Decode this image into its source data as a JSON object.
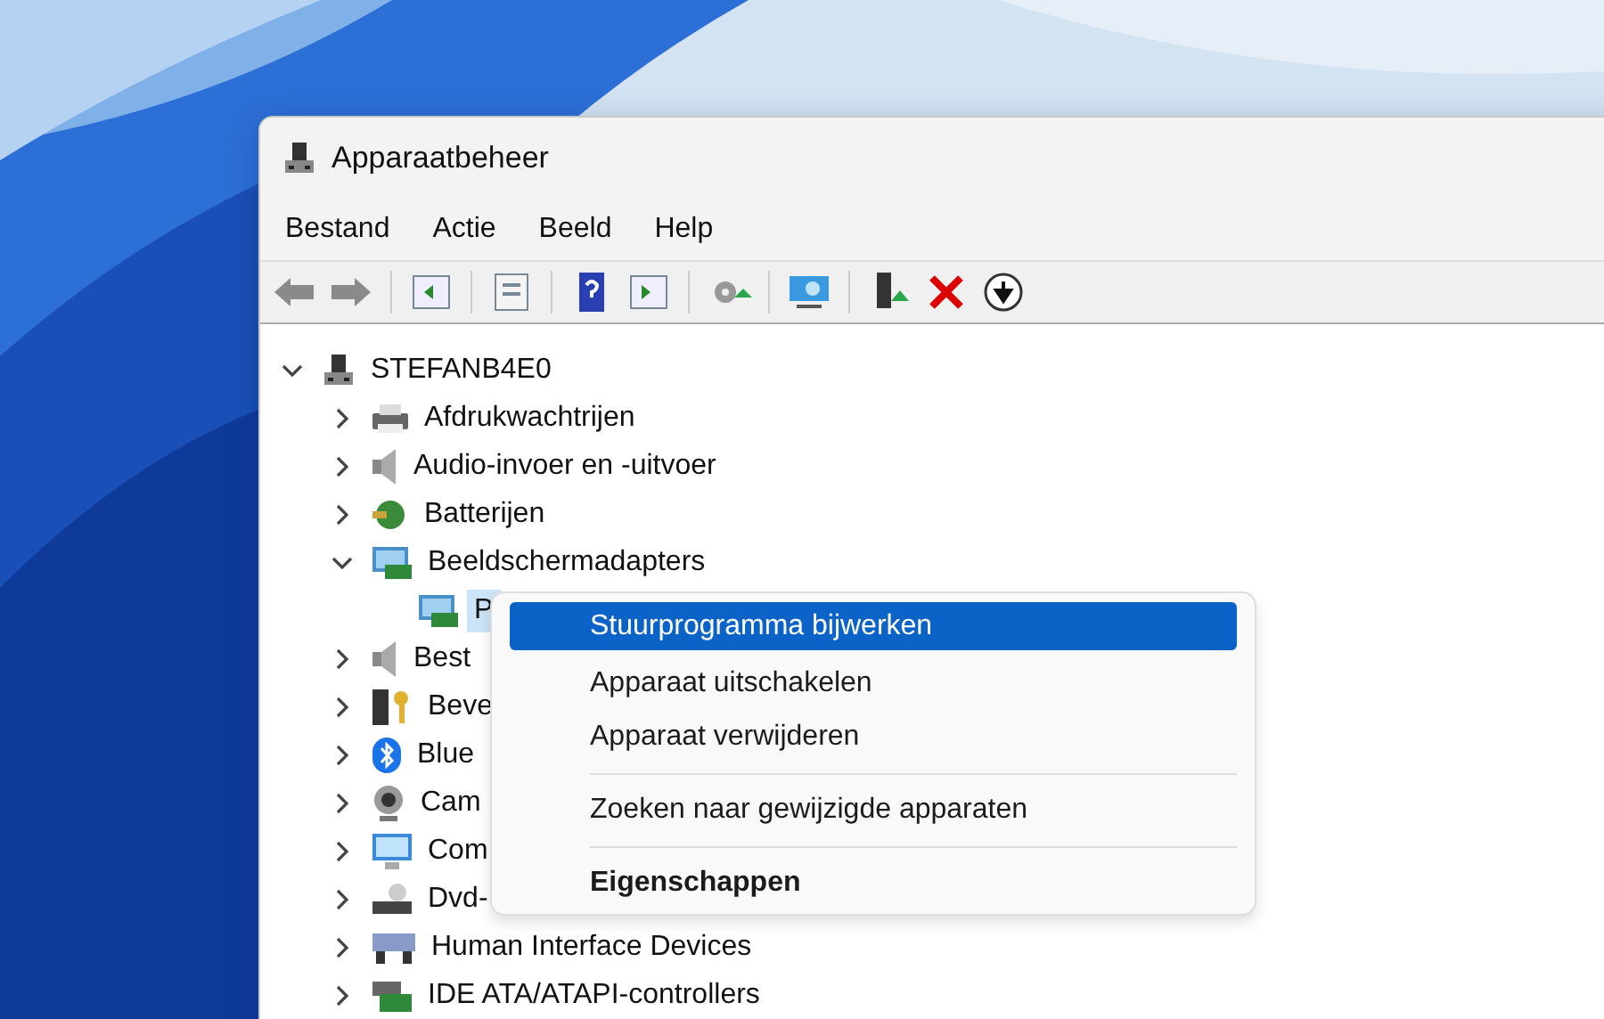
{
  "window": {
    "title": "Apparaatbeheer"
  },
  "menu": [
    {
      "label": "Bestand"
    },
    {
      "label": "Actie"
    },
    {
      "label": "Beeld"
    },
    {
      "label": "Help"
    }
  ],
  "tree": {
    "label": "STEFANB4E0",
    "expanded": true,
    "children": [
      {
        "label": "Afdrukwachtrijen",
        "expanded": false
      },
      {
        "label": "Audio-invoer en -uitvoer",
        "expanded": false
      },
      {
        "label": "Batterijen",
        "expanded": false
      },
      {
        "label": "Beeldschermadapters",
        "expanded": true,
        "children": [
          {
            "label": "P",
            "selected": true
          }
        ]
      },
      {
        "label": "Best",
        "expanded": false
      },
      {
        "label": "Beve",
        "expanded": false
      },
      {
        "label": "Blue",
        "expanded": false
      },
      {
        "label": "Cam",
        "expanded": false
      },
      {
        "label": "Com",
        "expanded": false
      },
      {
        "label": "Dvd-",
        "expanded": false
      },
      {
        "label": "Human Interface Devices",
        "expanded": false
      },
      {
        "label": "IDE ATA/ATAPI-controllers",
        "expanded": false
      }
    ]
  },
  "context_menu": [
    {
      "kind": "item",
      "label": "Stuurprogramma bijwerken",
      "selected": true,
      "default": false
    },
    {
      "kind": "item",
      "label": "Apparaat uitschakelen",
      "selected": false,
      "default": false
    },
    {
      "kind": "item",
      "label": "Apparaat verwijderen",
      "selected": false,
      "default": false
    },
    {
      "kind": "separator"
    },
    {
      "kind": "item",
      "label": "Zoeken naar gewijzigde apparaten",
      "selected": false,
      "default": false
    },
    {
      "kind": "separator"
    },
    {
      "kind": "item",
      "label": "Eigenschappen",
      "selected": false,
      "default": true
    }
  ]
}
